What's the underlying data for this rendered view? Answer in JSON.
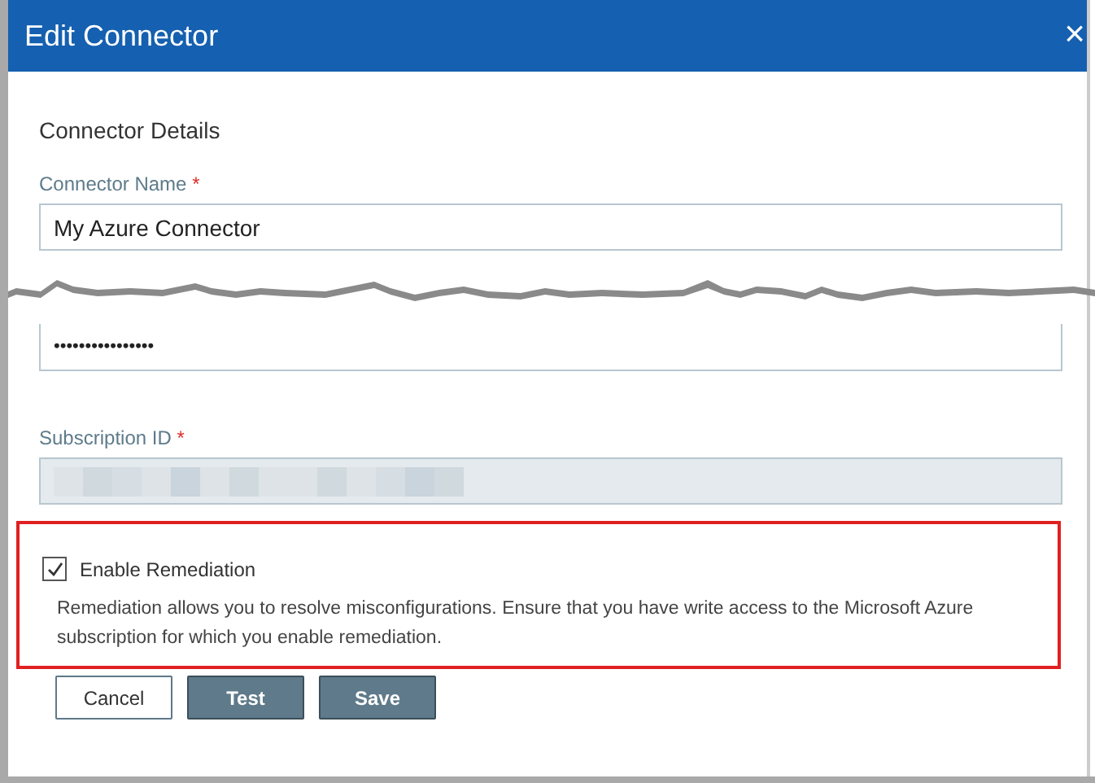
{
  "window": {
    "title": "Edit Connector",
    "close": "×"
  },
  "section_heading": "Connector Details",
  "fields": [
    {
      "kind": "text",
      "label": "Connector Name",
      "required_mark": "*",
      "value": "My Azure Connector"
    },
    {
      "kind": "torn"
    },
    {
      "kind": "password",
      "value": "••••••••••••••••"
    },
    {
      "kind": "redacted",
      "label": "Subscription ID",
      "required_mark": "*",
      "disabled": true
    }
  ],
  "remediation": {
    "checked": true,
    "label": "Enable Remediation",
    "description": "Remediation allows you to resolve misconfigurations. Ensure that you have write access to the Microsoft Azure subscription for which you enable remediation.",
    "highlighted": true
  },
  "buttons": [
    {
      "label": "Cancel",
      "kind": "secondary"
    },
    {
      "label": "Test",
      "kind": "primary"
    },
    {
      "label": "Save",
      "kind": "primary"
    }
  ]
}
